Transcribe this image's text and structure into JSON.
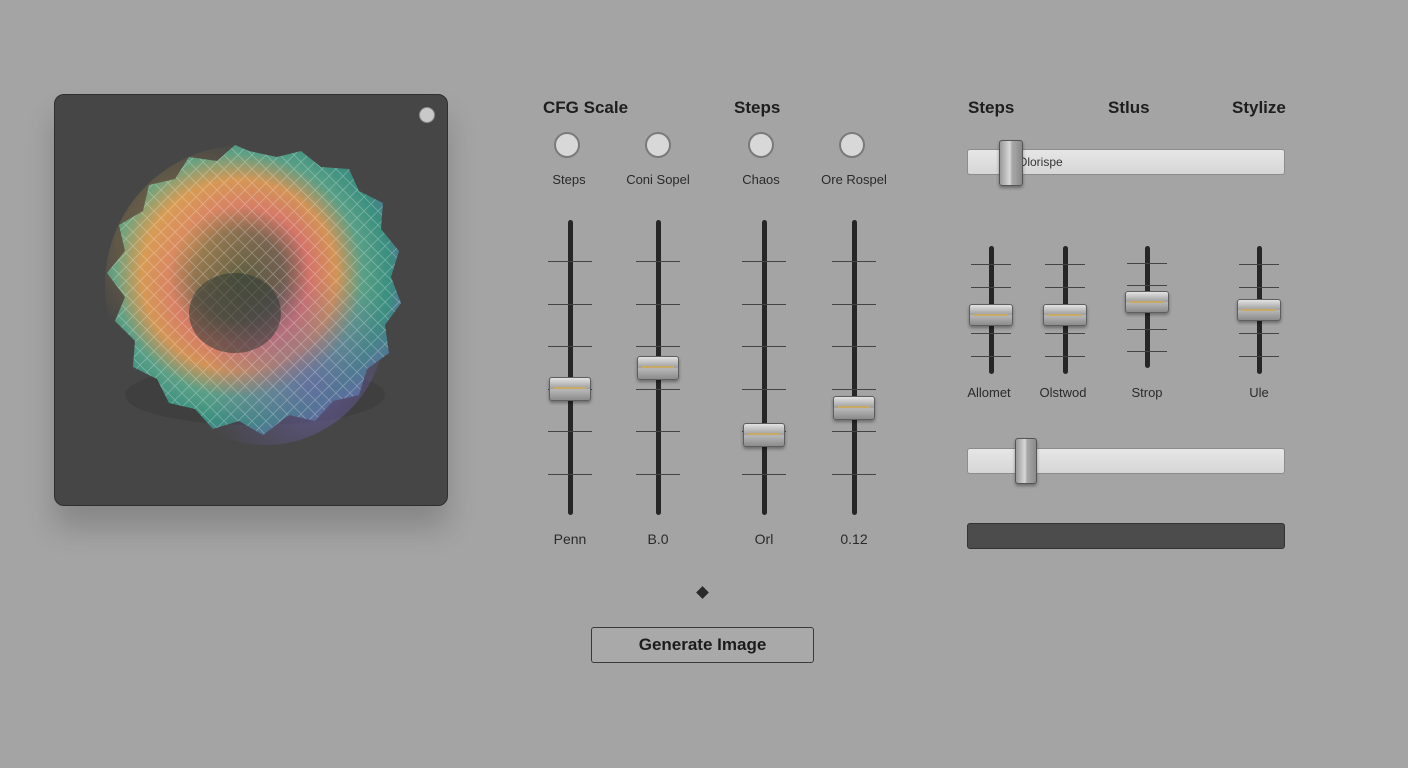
{
  "preview": {
    "alt": "generated textured sphere"
  },
  "headers": {
    "cfg_scale": "CFG Scale",
    "steps": "Steps",
    "steps_right": "Steps",
    "stlus": "Stlus",
    "stylize": "Stylize"
  },
  "radios": [
    {
      "label": "Steps"
    },
    {
      "label": "Coni Sopel"
    },
    {
      "label": "Chaos"
    },
    {
      "label": "Ore Rospel"
    }
  ],
  "faders": [
    {
      "value_label": "Penn",
      "level": 0.42
    },
    {
      "value_label": "B.0",
      "level": 0.5
    },
    {
      "value_label": "Orl",
      "level": 0.25
    },
    {
      "value_label": "0.12",
      "level": 0.35
    }
  ],
  "top_slider": {
    "text": "Olorispe",
    "level": 0.1
  },
  "small_faders": [
    {
      "label": "Allomet",
      "level": 0.45
    },
    {
      "label": "Olstwod",
      "level": 0.45
    },
    {
      "label": "Strop",
      "level": 0.55
    },
    {
      "label": "Ule",
      "level": 0.5
    }
  ],
  "bottom_slider": {
    "level": 0.15
  },
  "generate_button": {
    "label": "Generate Image"
  },
  "colors": {
    "background": "#a4a4a4",
    "panel": "#464646",
    "accent": "#c8aa64"
  }
}
